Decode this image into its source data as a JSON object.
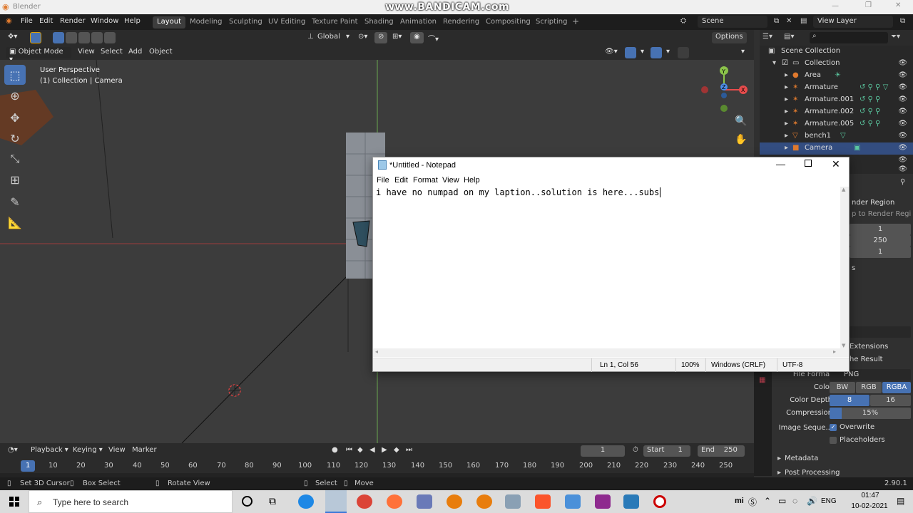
{
  "window": {
    "title": "Blender",
    "watermark": "www.BANDICAM.com"
  },
  "menubar": {
    "items": [
      "File",
      "Edit",
      "Render",
      "Window",
      "Help"
    ],
    "workspaces": [
      "Layout",
      "Modeling",
      "Sculpting",
      "UV Editing",
      "Texture Paint",
      "Shading",
      "Animation",
      "Rendering",
      "Compositing",
      "Scripting"
    ],
    "active_workspace": "Layout",
    "add_tab": "+",
    "scene": "Scene",
    "view_layer": "View Layer"
  },
  "viewport_header": {
    "transform_orientation": "Global",
    "options": "Options",
    "mode": "Object Mode",
    "menus": [
      "View",
      "Select",
      "Add",
      "Object"
    ]
  },
  "viewport": {
    "info_line1": "User Perspective",
    "info_line2": "(1) Collection | Camera",
    "gizmo_axis": {
      "y": "Y",
      "z": "Z",
      "x": "X"
    }
  },
  "outliner": {
    "rows": [
      {
        "label": "Scene Collection",
        "indent": 0,
        "kind": "scene"
      },
      {
        "label": "Collection",
        "indent": 1,
        "kind": "collection"
      },
      {
        "label": "Area",
        "indent": 2,
        "kind": "light"
      },
      {
        "label": "Armature",
        "indent": 2,
        "kind": "armature"
      },
      {
        "label": "Armature.001",
        "indent": 2,
        "kind": "armature"
      },
      {
        "label": "Armature.002",
        "indent": 2,
        "kind": "armature"
      },
      {
        "label": "Armature.005",
        "indent": 2,
        "kind": "armature"
      },
      {
        "label": "bench1",
        "indent": 2,
        "kind": "mesh"
      },
      {
        "label": "Camera",
        "indent": 2,
        "kind": "camera",
        "selected": true
      }
    ]
  },
  "properties": {
    "partial_labels": {
      "render_region": "nder Region",
      "to_render_region": "p to Render Regi",
      "extensions": "Extensions",
      "the_result": "he Result",
      "s": "s"
    },
    "frame_values": [
      "1",
      "250",
      "1"
    ],
    "file_format_label": "File Format",
    "file_format": "PNG",
    "color_label": "Color",
    "color_options": [
      "BW",
      "RGB",
      "RGBA"
    ],
    "color_active": "RGBA",
    "depth_label": "Color Depth",
    "depth_options": [
      "8",
      "16"
    ],
    "depth_active": "8",
    "compression_label": "Compression",
    "compression": "15%",
    "compression_fraction": 0.15,
    "image_seq_label": "Image Seque...",
    "overwrite": "Overwrite",
    "overwrite_checked": true,
    "placeholders": "Placeholders",
    "placeholders_checked": false,
    "sections": [
      "Metadata",
      "Post Processing"
    ]
  },
  "notepad": {
    "title": "*Untitled - Notepad",
    "menu": [
      "File",
      "Edit",
      "Format",
      "View",
      "Help"
    ],
    "text": "i have no numpad on my laption..solution is here...subs",
    "status": {
      "position": "Ln 1, Col 56",
      "zoom": "100%",
      "line_endings": "Windows (CRLF)",
      "encoding": "UTF-8"
    }
  },
  "timeline": {
    "menus": [
      "Playback",
      "Keying",
      "View",
      "Marker"
    ],
    "current_frame": "1",
    "start_label": "Start",
    "start": "1",
    "end_label": "End",
    "end": "250",
    "ticks": [
      "1",
      "10",
      "20",
      "30",
      "40",
      "50",
      "60",
      "70",
      "80",
      "90",
      "100",
      "110",
      "120",
      "130",
      "140",
      "150",
      "160",
      "170",
      "180",
      "190",
      "200",
      "210",
      "220",
      "230",
      "240",
      "250"
    ]
  },
  "statusbar": {
    "items": [
      "Set 3D Cursor",
      "Box Select",
      "Rotate View",
      "Select",
      "Move"
    ],
    "version": "2.90.1"
  },
  "taskbar": {
    "search_placeholder": "Type here to search",
    "language": "ENG",
    "time": "01:47",
    "date": "10-02-2021",
    "tray_text": "mi"
  },
  "colors": {
    "blender_accent": "#4772b3",
    "selection": "#334d80",
    "axis_x": "#e84c4c",
    "axis_y": "#8bc34a",
    "axis_z": "#4c8ce8",
    "orange": "#e07a2e"
  }
}
